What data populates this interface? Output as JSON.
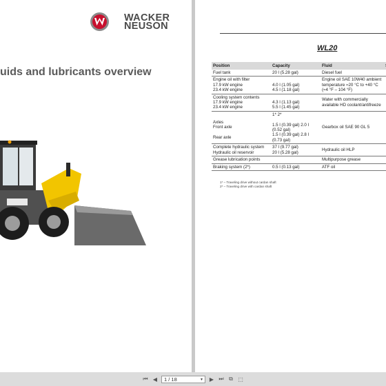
{
  "left_page": {
    "logo": {
      "line1": "WACKER",
      "line2": "NEUSON"
    },
    "title": "uids and lubricants overview"
  },
  "right_page": {
    "model": "WL20",
    "table": {
      "headers": [
        "Position",
        "Capacity",
        "Fluid",
        "S"
      ],
      "rows": [
        {
          "position": "Fuel tank",
          "capacity": "20 l (5.28 gal)",
          "fluid": "Diesel fuel",
          "s": ""
        },
        {
          "position": "Engine oil with filter\n17.9 kW engine\n23.4 kW engine",
          "capacity": "\n4.0 l (1.05 gal)\n4.5 l (1.18 gal)",
          "fluid": "Engine oil SAE 10W40 ambient temperature ≈20 °C to +40 °C (≈4 °F – 104 °F)",
          "s": ""
        },
        {
          "position": "Cooling system contents\n17.9 kW engine\n23.4 kW engine",
          "capacity": "\n4.3 l (1.13 gal)\n5.5 l (1.45 gal)",
          "fluid": "Water with commercially available HD coolant/antifreeze",
          "s": ""
        },
        {
          "position": "\nAxles\nFront axle\n\nRear axle",
          "capacity": "1*          2*\n\n1.5 l (0.39 gal)  2.0 l\n(0.52 gal)\n1.5 l (0.39 gal)  2.8 l\n(0.73 gal)",
          "fluid": "Gearbox oil SAE 90 GL 5",
          "s": ""
        },
        {
          "position": "Complete hydraulic system\nHydraulic oil reservoir",
          "capacity": "37 l (9.77 gal)\n20 l (5.28 gal)",
          "fluid": "Hydraulic oil HLP",
          "s": ""
        },
        {
          "position": "Grease lubrication points",
          "capacity": "",
          "fluid": "Multipurpose grease",
          "s": ""
        },
        {
          "position": "Braking system (2*)",
          "capacity": "0.5 l (0.13 gal)",
          "fluid": "ATF oil",
          "s": ""
        }
      ]
    },
    "footnotes": [
      "1* – Traveling drive without cardan shaft",
      "2* – Traveling drive with cardan shaft"
    ]
  },
  "toolbar": {
    "page_indicator": "1 / 18",
    "icons": [
      "first-page-icon",
      "prev-page-icon",
      "next-page-icon",
      "last-page-icon",
      "rotate-icon",
      "fit-icon"
    ]
  },
  "colors": {
    "brand_red": "#c8102e",
    "header_gray": "#d9d9d9",
    "loader_yellow": "#f2c500"
  }
}
